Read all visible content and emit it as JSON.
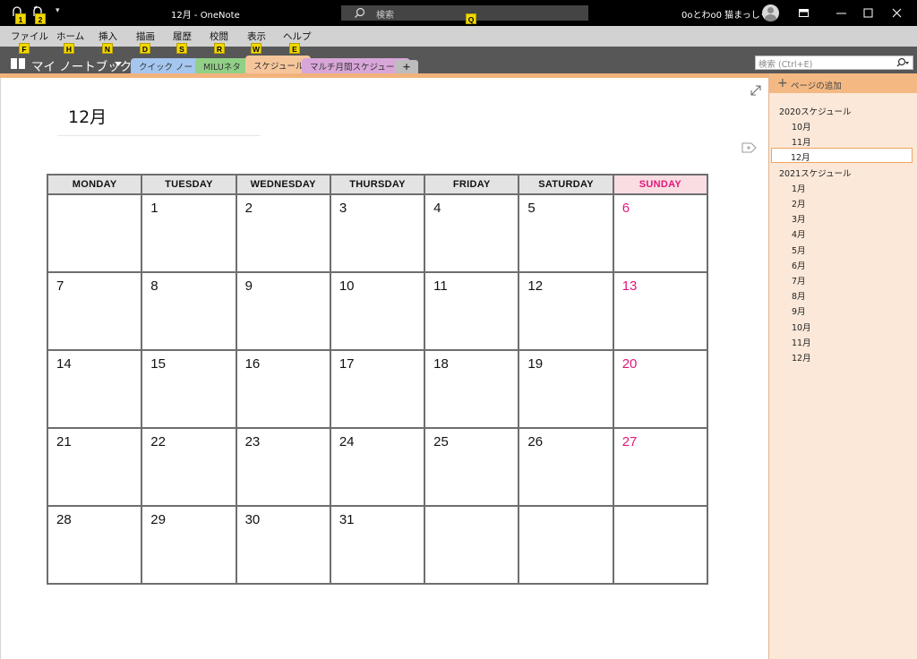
{
  "window": {
    "title": "12月  -  OneNote",
    "search_label": "検索",
    "user": "0oとわo0 猫まっしぐら"
  },
  "keytips": {
    "qat1": "1",
    "qat2": "2",
    "search": "Q",
    "file": "F",
    "home": "H",
    "insert": "N",
    "draw": "D",
    "history": "S",
    "review": "R",
    "view": "W",
    "help": "E"
  },
  "menu": {
    "file": "ファイル",
    "home": "ホーム",
    "insert": "挿入",
    "draw": "描画",
    "history": "履歴",
    "review": "校閲",
    "view": "表示",
    "help": "ヘルプ"
  },
  "notebook": {
    "name": "マイ ノートブック",
    "search_placeholder": "検索 (Ctrl+E)",
    "sections": [
      {
        "label": "クイック ノート",
        "color": "#a5c6ef"
      },
      {
        "label": "MILUネタ",
        "color": "#91d087"
      },
      {
        "label": "スケジュール",
        "color": "#f6c69b"
      },
      {
        "label": "マルチ月間スケジュール",
        "color": "#d8a6d8"
      }
    ],
    "add_tab": "+"
  },
  "page": {
    "title": "12月"
  },
  "calendar": {
    "headers": [
      "MONDAY",
      "TUESDAY",
      "WEDNESDAY",
      "THURSDAY",
      "FRIDAY",
      "SATURDAY",
      "SUNDAY"
    ],
    "weeks": [
      [
        "",
        "1",
        "2",
        "3",
        "4",
        "5",
        "6"
      ],
      [
        "7",
        "8",
        "9",
        "10",
        "11",
        "12",
        "13"
      ],
      [
        "14",
        "15",
        "16",
        "17",
        "18",
        "19",
        "20"
      ],
      [
        "21",
        "22",
        "23",
        "24",
        "25",
        "26",
        "27"
      ],
      [
        "28",
        "29",
        "30",
        "31",
        "",
        "",
        ""
      ]
    ],
    "sunday_color": "#e0187c"
  },
  "pages_pane": {
    "add_page": "ページの追加",
    "groups": [
      {
        "label": "2020スケジュール",
        "pages": [
          "10月",
          "11月",
          "12月"
        ]
      },
      {
        "label": "2021スケジュール",
        "pages": [
          "1月",
          "2月",
          "3月",
          "4月",
          "5月",
          "6月",
          "7月",
          "8月",
          "9月",
          "10月",
          "11月",
          "12月"
        ]
      }
    ],
    "selected": "12月"
  }
}
